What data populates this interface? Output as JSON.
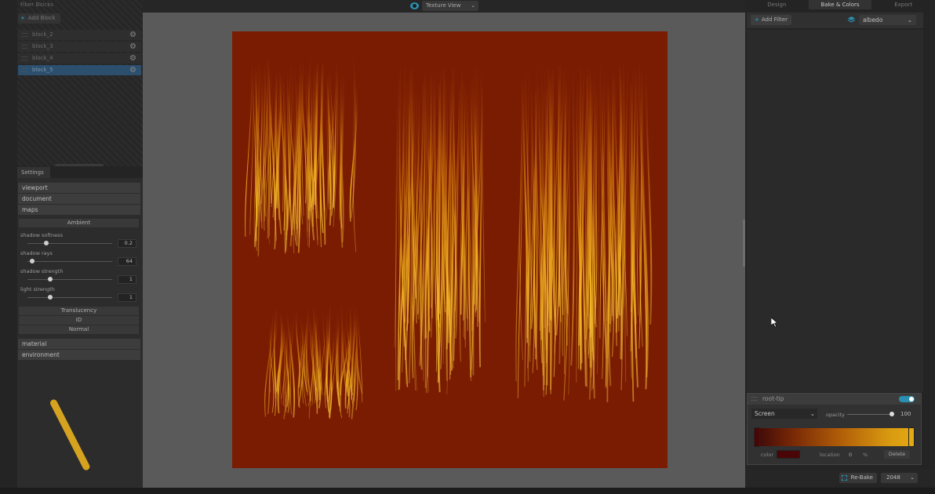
{
  "fiber_blocks": {
    "title": "Fiber Blocks",
    "add_label": "Add Block",
    "blocks": [
      {
        "label": "block_2"
      },
      {
        "label": "block_3"
      },
      {
        "label": "block_4"
      },
      {
        "label": "block_5",
        "selected": true
      }
    ]
  },
  "settings": {
    "tab_label": "Settings",
    "sections_top": [
      "viewport",
      "document",
      "maps"
    ],
    "ambient_header": "Ambient",
    "params": [
      {
        "label": "shadow softness",
        "value": "0.2",
        "level": 0.22
      },
      {
        "label": "shadow rays",
        "value": "64",
        "level": 0.06
      },
      {
        "label": "shadow strength",
        "value": "1",
        "level": 0.27
      },
      {
        "label": "light strength",
        "value": "1",
        "level": 0.27
      }
    ],
    "sub_headers": [
      "Translucency",
      "ID",
      "Normal"
    ],
    "sections_bottom": [
      "material",
      "environment"
    ]
  },
  "viewport": {
    "view_mode": "Texture View"
  },
  "right_panel": {
    "tabs": [
      {
        "label": "Design"
      },
      {
        "label": "Bake & Colors",
        "active": true
      },
      {
        "label": "Export"
      }
    ],
    "add_filter_label": "Add Filter",
    "map_select": "albedo",
    "filter": {
      "name": "root-tip",
      "enabled": true,
      "blend_mode": "Screen",
      "opacity_label": "opacity",
      "opacity_value": "100",
      "color_label": "color",
      "location_label": "location",
      "location_value": "0",
      "location_unit": "%",
      "delete_label": "Delete",
      "gradient_stops": [
        "#4a0606",
        "#e3a914"
      ]
    },
    "rebake_label": "Re-Bake",
    "resolution": "2048"
  },
  "colors": {
    "accent": "#2a8fb0",
    "canvas_bg": "#7a1c02",
    "hair_highlight": "#f2b320",
    "handle": "#d6a320"
  }
}
